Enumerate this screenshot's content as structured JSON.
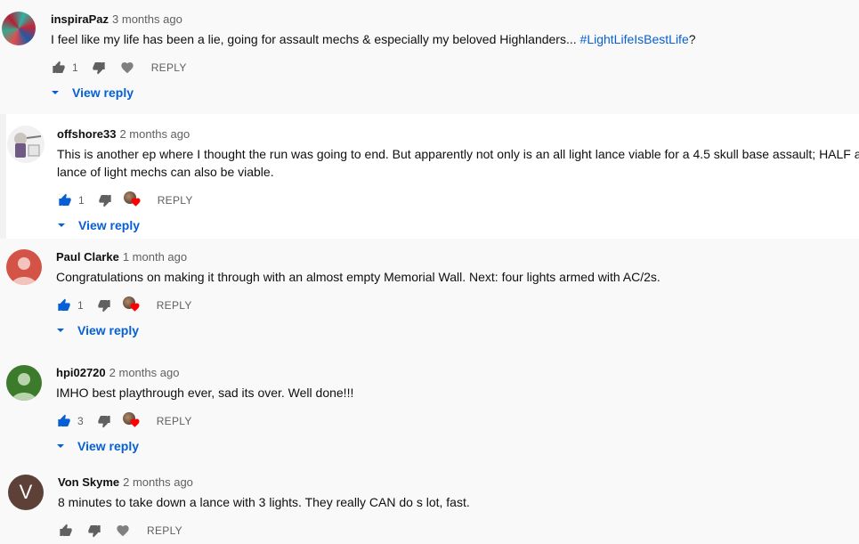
{
  "comments": [
    {
      "author": "inspiraPaz",
      "time": "3 months ago",
      "text": "I feel like my life has been a lie, going for assault mechs & especially my beloved Highlanders... ",
      "hashtag": "#LightLifeIsBestLife",
      "text_suffix": "?",
      "likes": "1",
      "reply_label": "REPLY",
      "view_reply": "View reply"
    },
    {
      "author": "offshore33",
      "time": "2 months ago",
      "text_line1": "This is another ep where I thought the run was going to end.  But apparently not only is an all light lance viable for a 4.5 skull base assault; HALF a",
      "text_line2": "lance of light mechs can also be viable.",
      "likes": "1",
      "reply_label": "REPLY",
      "view_reply": "View reply"
    },
    {
      "author": "Paul Clarke",
      "time": "1 month ago",
      "text": "Congratulations on making it through with an almost empty Memorial Wall. Next: four lights armed with AC/2s.",
      "likes": "1",
      "reply_label": "REPLY",
      "view_reply": "View reply"
    },
    {
      "author": "hpi02720",
      "time": "2 months ago",
      "text": "IMHO best playthrough ever, sad its over. Well done!!!",
      "likes": "3",
      "reply_label": "REPLY",
      "view_reply": "View reply"
    },
    {
      "author": "Von Skyme",
      "time": "2 months ago",
      "avatar_letter": "V",
      "text": "8 minutes to take down a lance with 3 lights. They really CAN do s lot, fast.",
      "reply_label": "REPLY"
    }
  ],
  "colors": {
    "link_blue": "#065fd4",
    "liked_blue": "#065fd4",
    "muted": "#606060",
    "heart_red": "#ff0000"
  },
  "icons": [
    "thumb-up-icon",
    "thumb-down-icon",
    "heart-icon",
    "chevron-down-icon"
  ]
}
